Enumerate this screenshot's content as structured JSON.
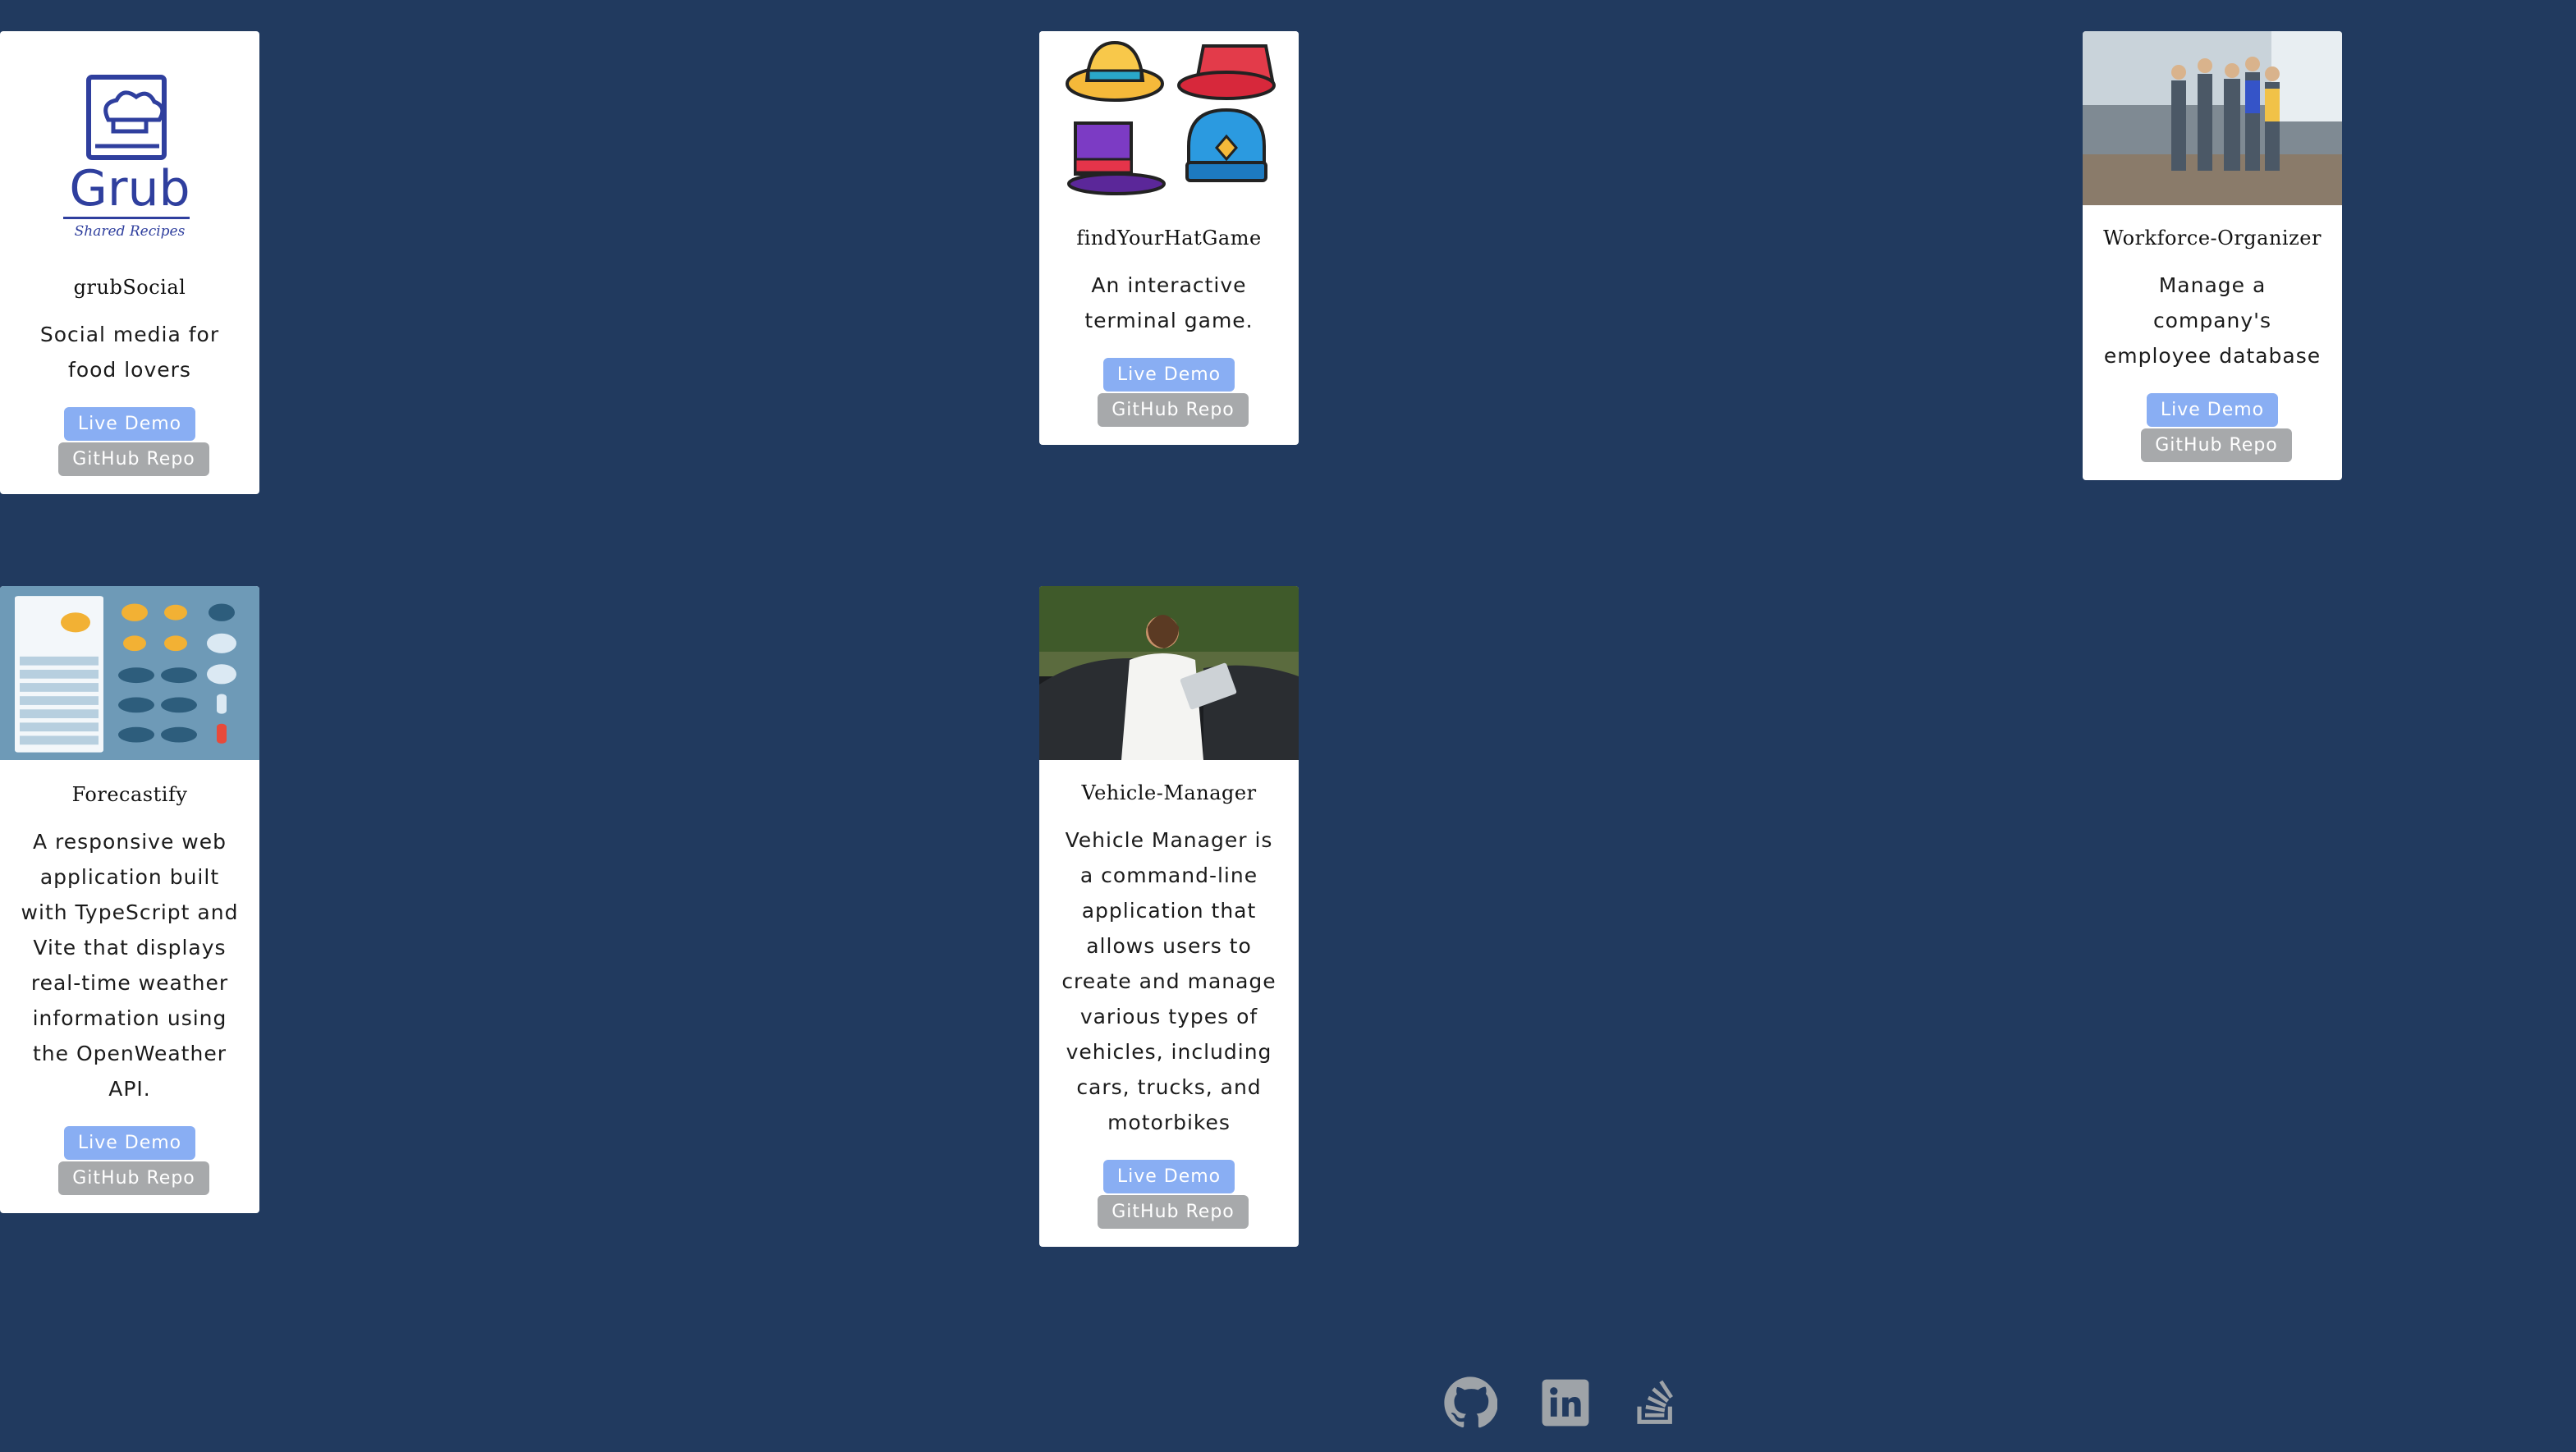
{
  "projects": [
    {
      "title": "grubSocial",
      "description": "Social media for food lovers",
      "live_label": "Live Demo",
      "repo_label": "GitHub Repo",
      "logo": {
        "wordmark": "Grub",
        "tagline": "Shared Recipes"
      }
    },
    {
      "title": "findYourHatGame",
      "description": "An interactive terminal game.",
      "live_label": "Live Demo",
      "repo_label": "GitHub Repo"
    },
    {
      "title": "Workforce-Organizer",
      "description": "Manage a company's employee database",
      "live_label": "Live Demo",
      "repo_label": "GitHub Repo"
    },
    {
      "title": "Forecastify",
      "description": "A responsive web application built with TypeScript and Vite that displays real-time weather information using the OpenWeather API.",
      "live_label": "Live Demo",
      "repo_label": "GitHub Repo"
    },
    {
      "title": "Vehicle-Manager",
      "description": "Vehicle Manager is a command-line application that allows users to create and manage various types of vehicles, including cars, trucks, and motorbikes",
      "live_label": "Live Demo",
      "repo_label": "GitHub Repo"
    }
  ],
  "footer": {
    "icons": [
      "github-icon",
      "linkedin-icon",
      "stackoverflow-icon"
    ]
  },
  "colors": {
    "background": "#213a5f",
    "live_button": "#89aef3",
    "repo_button": "#a7a9ab",
    "logo_blue": "#2f3f9e"
  }
}
